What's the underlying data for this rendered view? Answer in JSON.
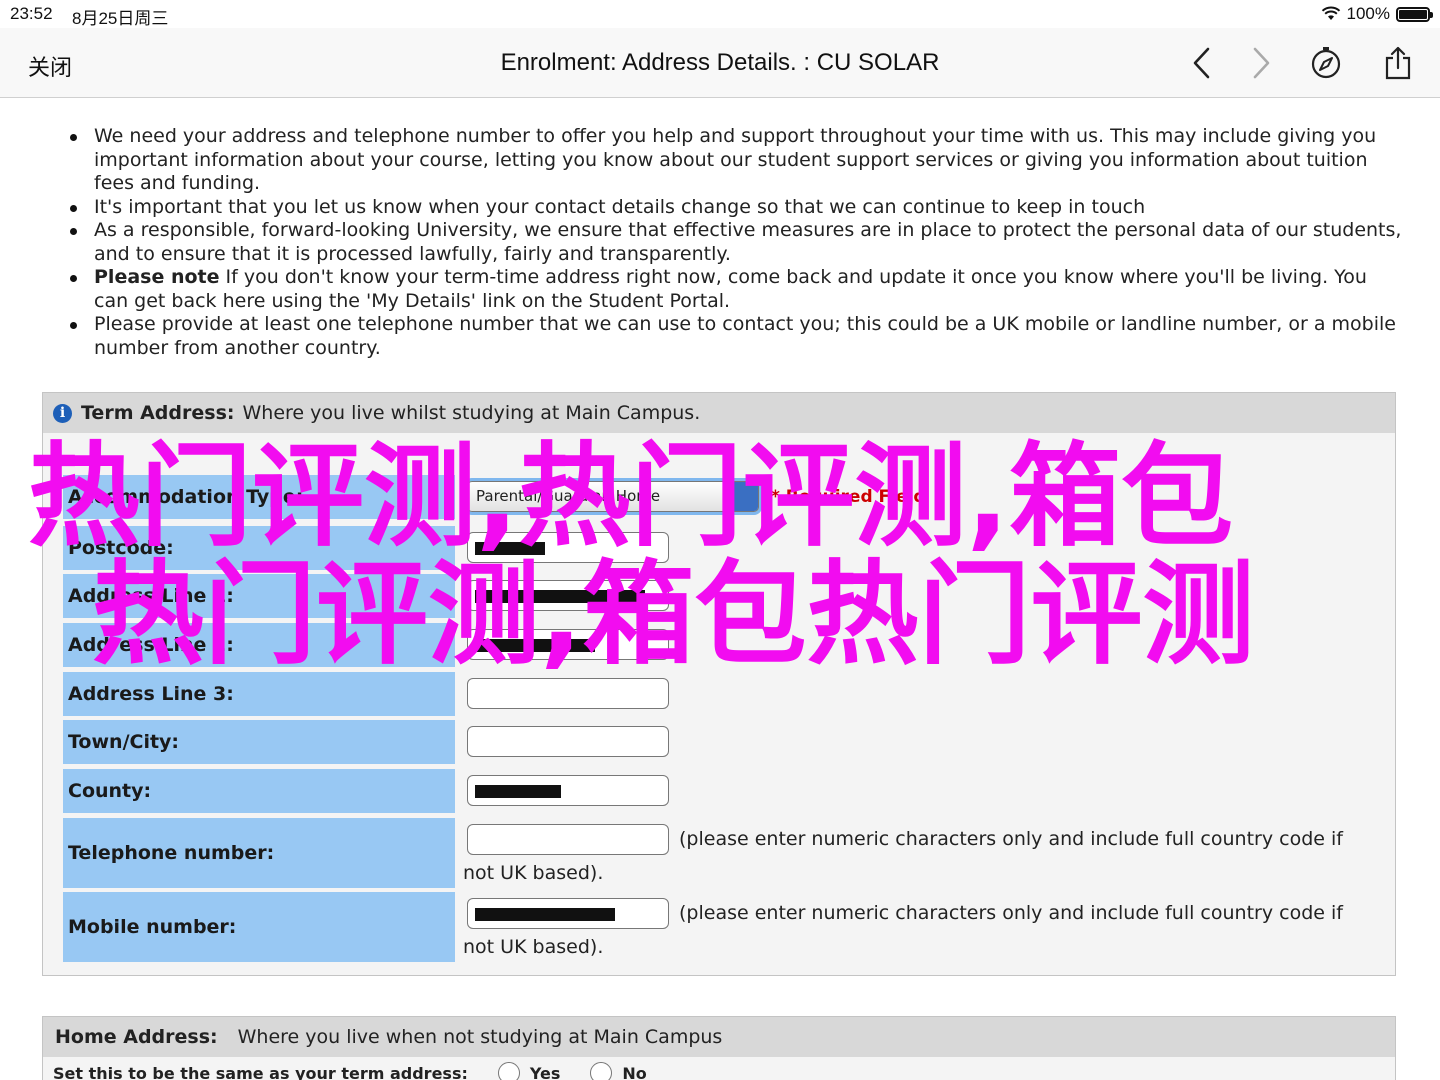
{
  "status": {
    "time": "23:52",
    "date": "8月25日周三",
    "battery": "100%"
  },
  "nav": {
    "close": "关闭",
    "title": "Enrolment: Address Details. : CU SOLAR"
  },
  "notes": [
    {
      "bold": "",
      "text": "We need your address and telephone number to offer you help and support throughout your time with us. This may include giving you important information about your course, letting you know about our student support services or giving you information about tuition fees and funding."
    },
    {
      "bold": "",
      "text": "It's important that you let us know when your contact details change so that we can continue to keep in touch"
    },
    {
      "bold": "",
      "text": "As a responsible, forward-looking University, we ensure that effective measures are in place to protect the personal data of our students, and to ensure that it is processed lawfully, fairly and transparently."
    },
    {
      "bold": "Please note",
      "text": " If you don't know your term-time address right now, come back and update it once you know where you'll be living. You can get back here using the 'My Details' link on the Student Portal."
    },
    {
      "bold": "",
      "text": "Please provide at least one telephone number that we can use to contact you; this could be a UK mobile or landline number, or a mobile number from another country."
    }
  ],
  "term": {
    "heading": "Term Address:",
    "subheading": "Where you live whilst studying at Main Campus.",
    "accommodation_label": "Accommodation Type:",
    "accommodation_value": "Parental/Guardian Home",
    "required": "* Required Field",
    "postcode": "Postcode:",
    "line1": "Address Line 1:",
    "line2": "Address Line 2:",
    "line3": "Address Line 3:",
    "town": "Town/City:",
    "county": "County:",
    "telephone": "Telephone number:",
    "mobile": "Mobile number:",
    "hint": "(please enter numeric characters only and include full country code if not UK based)."
  },
  "home": {
    "heading": "Home Address:",
    "subheading": "Where you live when not studying at Main Campus",
    "same_label": "Set this to be the same as your term address:",
    "yes": "Yes",
    "no": "No"
  },
  "watermark": {
    "line1": "热门评测,热门评测,箱包",
    "line2": "热门评测,箱包热门评测"
  },
  "colors": {
    "label_bg": "#98c8f3",
    "watermark": "#f20cf0"
  }
}
